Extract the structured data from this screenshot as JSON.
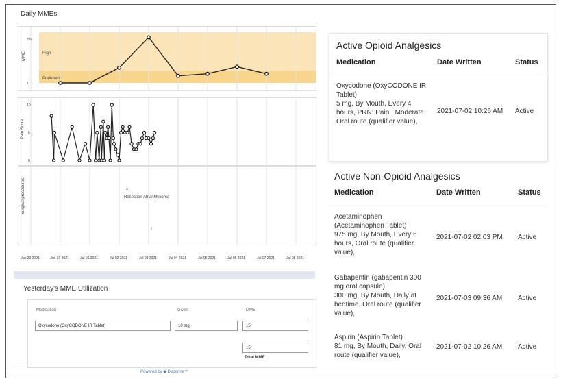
{
  "daily_mme": {
    "title": "Daily MMEs",
    "y_axis_label": "MME",
    "y_ticks": [
      "50",
      "0"
    ],
    "zone_labels": {
      "high": "High",
      "preferred": "Preferred"
    }
  },
  "pain_score": {
    "y_axis_label": "Pain Score",
    "y_ticks": [
      "10",
      "5",
      "0"
    ]
  },
  "surgical": {
    "y_axis_label": "Surgical procedures",
    "event_label": "Resection Atrial Myxoma"
  },
  "x_ticks": [
    "Jun 29 2021",
    "Jun 30 2021",
    "Jul 01 2021",
    "Jul 02 2021",
    "Jul 03 2021",
    "Jul 04 2021",
    "Jul 05 2021",
    "Jul 06 2021",
    "Jul 07 2021",
    "Jul 08 2021"
  ],
  "chart_data": [
    {
      "type": "line",
      "title": "Daily MMEs",
      "ylabel": "MME",
      "ylim": [
        0,
        50
      ],
      "x": [
        "Jun 30 2021",
        "Jul 01 2021",
        "Jul 02 2021",
        "Jul 03 2021",
        "Jul 04 2021",
        "Jul 05 2021",
        "Jul 06 2021",
        "Jul 07 2021"
      ],
      "series": [
        {
          "values": [
            0,
            0,
            15,
            45,
            7,
            9,
            16,
            9
          ]
        }
      ],
      "bands": [
        {
          "label": "High",
          "range": [
            12,
            50
          ]
        },
        {
          "label": "Preferred",
          "range": [
            0,
            12
          ]
        }
      ]
    },
    {
      "type": "line",
      "ylabel": "Pain Score",
      "ylim": [
        0,
        10
      ],
      "x_days": [
        0.1,
        0.18,
        0.2,
        0.5,
        0.8,
        1.05,
        1.25,
        1.4,
        1.52,
        1.6,
        1.65,
        1.72,
        1.78,
        1.8,
        1.86,
        1.9,
        1.93,
        1.98,
        2.02,
        2.05,
        2.1,
        2.15,
        2.2,
        2.23,
        2.28,
        2.35,
        2.4,
        2.46,
        2.52,
        2.6,
        2.68,
        2.75,
        2.82,
        2.9,
        2.98,
        3.05,
        3.12,
        3.18,
        3.25,
        3.32,
        3.4,
        3.48,
        3.55,
        3.6
      ],
      "values": [
        8,
        0,
        5,
        0,
        6,
        0,
        3,
        0,
        10,
        0,
        5,
        0,
        6,
        0,
        7,
        0,
        5,
        4,
        6,
        4,
        0,
        10,
        4,
        3,
        2,
        1,
        0,
        5,
        6,
        5,
        5,
        6,
        3,
        2,
        2,
        3,
        3,
        4,
        5,
        4,
        4,
        3,
        4,
        5
      ]
    }
  ],
  "utilization": {
    "title": "Yesterday's MME Utilization",
    "headers": {
      "medication": "Medication",
      "given": "Given",
      "mme": "MME"
    },
    "row": {
      "medication": "Oxycodone (OxyCODONE IR Tablet)",
      "given": "10 mg",
      "mme": "15"
    },
    "total_value": "15",
    "total_label": "Total MME"
  },
  "powered_by": "Powered by ◆ Deponne™",
  "opioid": {
    "title": "Active Opioid Analgesics",
    "headers": {
      "medication": "Medication",
      "date": "Date Written",
      "status": "Status"
    },
    "rows": [
      {
        "medication": "Oxycodone (OxyCODONE IR Tablet)\n5 mg, By Mouth, Every 4 hours, PRN: Pain , Moderate, Oral route (qualifier value),",
        "date": "2021-07-02 10:26 AM",
        "status": "Active"
      }
    ]
  },
  "non_opioid": {
    "title": "Active Non-Opioid Analgesics",
    "headers": {
      "medication": "Medication",
      "date": "Date Written",
      "status": "Status"
    },
    "rows": [
      {
        "medication": "Acetaminophen (Acetaminophen Tablet)\n975 mg, By Mouth, Every 6 hours, Oral route (qualifier value),",
        "date": "2021-07-02 02:03 PM",
        "status": "Active"
      },
      {
        "medication": "Gabapentin (gabapentin 300 mg oral capsule)\n300 mg, By Mouth, Daily at bedtime, Oral route (qualifier value),",
        "date": "2021-07-03 09:36 AM",
        "status": "Active"
      },
      {
        "medication": "Aspirin (Aspirin Tablet)\n81 mg, By Mouth, Daily, Oral route (qualifier value),",
        "date": "2021-07-02 10:26 AM",
        "status": "Active"
      }
    ]
  },
  "colors": {
    "high_band": "#fbe5b8",
    "preferred_band": "#f8d58d",
    "line": "#222222"
  }
}
